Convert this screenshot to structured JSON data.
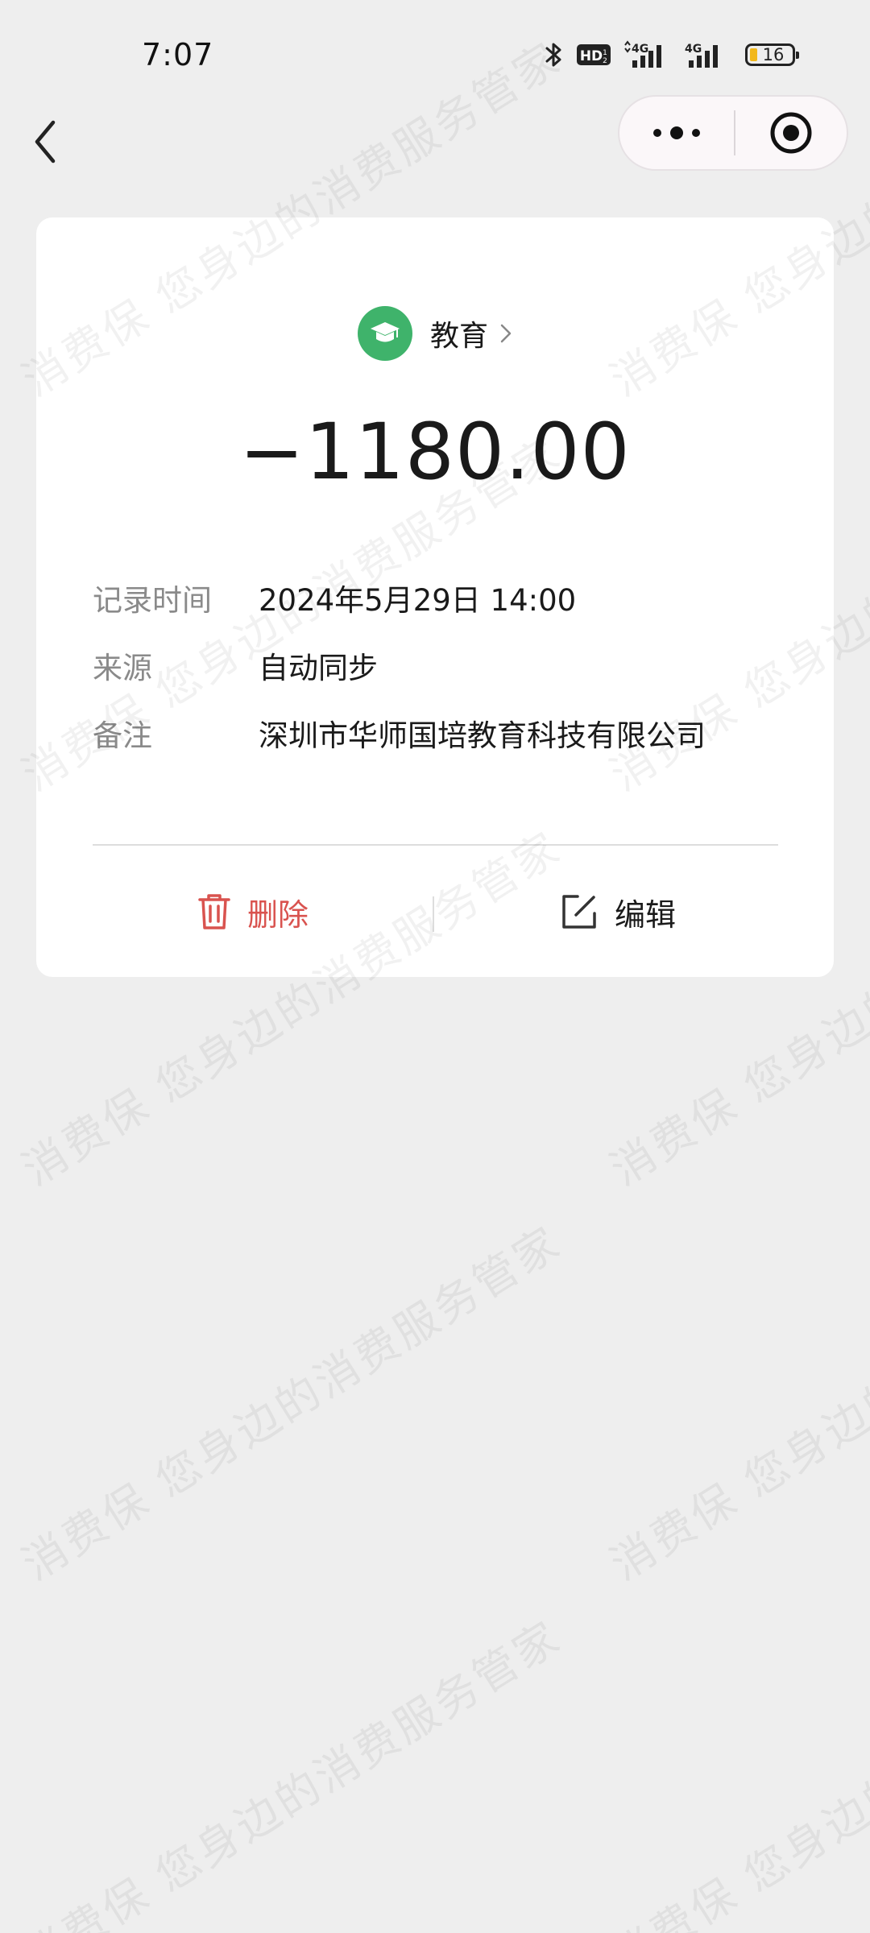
{
  "status_bar": {
    "time": "7:07",
    "hd_badge": "HD",
    "network_1": "4G",
    "network_2": "4G",
    "battery": "16",
    "icons": [
      "bluetooth-icon",
      "hd-icon",
      "signal-4g-icon",
      "signal-4g-icon",
      "battery-icon"
    ]
  },
  "nav": {
    "back_icon": "chevron-left-icon",
    "more_icon": "more-dots-icon",
    "close_icon": "target-close-icon"
  },
  "record": {
    "category": {
      "name": "教育",
      "icon": "graduation-cap-icon",
      "icon_color": "#3fb36b"
    },
    "amount": "−1180.00",
    "details": [
      {
        "label": "记录时间",
        "value": "2024年5月29日 14:00"
      },
      {
        "label": "来源",
        "value": "自动同步"
      },
      {
        "label": "备注",
        "value": "深圳市华师国培教育科技有限公司"
      }
    ]
  },
  "actions": {
    "delete_label": "删除",
    "edit_label": "编辑",
    "delete_color": "#d9534f"
  },
  "watermark": {
    "text": "消费保 您身边的消费服务管家"
  }
}
